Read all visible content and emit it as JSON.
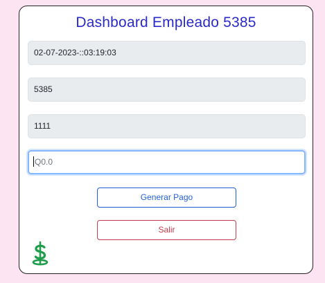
{
  "header": {
    "title": "Dashboard Empleado 5385"
  },
  "fields": {
    "datetime": "02-07-2023-::03:19:03",
    "employee_id": "5385",
    "code": "1111",
    "amount_placeholder": "Q0.0"
  },
  "buttons": {
    "generate_payment": "Generar Pago",
    "exit": "Salir"
  },
  "icons": {
    "money": "dollar-sign-icon"
  },
  "colors": {
    "title": "#2a2ac8",
    "primary": "#1f5fd6",
    "danger": "#c63a4d",
    "icon": "#1f9d4a",
    "background": "#fde4f2"
  }
}
